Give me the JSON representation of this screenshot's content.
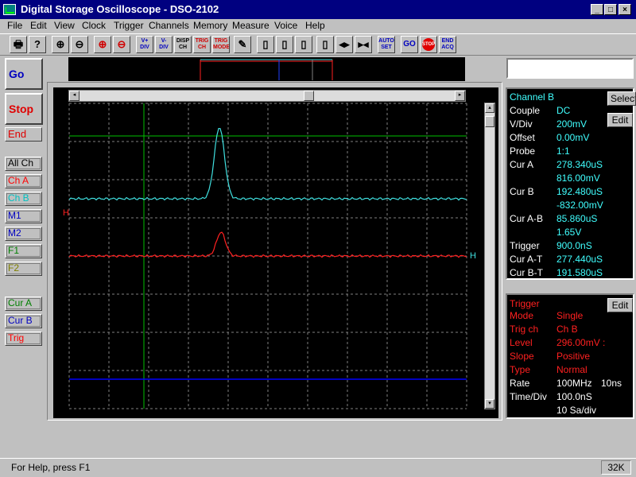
{
  "window": {
    "title": "Digital Storage Oscilloscope - DSO-2102",
    "minimize": "_",
    "maximize": "□",
    "close": "×"
  },
  "menu": [
    "File",
    "Edit",
    "View",
    "Clock",
    "Trigger",
    "Channels",
    "Memory",
    "Measure",
    "Voice",
    "Help"
  ],
  "toolbar": [
    {
      "id": "print",
      "text": "🖶"
    },
    {
      "id": "help",
      "text": "?"
    },
    {
      "id": "zoom-in",
      "text": "⊕"
    },
    {
      "id": "zoom-out",
      "text": "⊖"
    },
    {
      "id": "time-zoom-in",
      "text": "⊕"
    },
    {
      "id": "time-zoom-out",
      "text": "⊖"
    },
    {
      "id": "v-div-up",
      "text": "V+ DIV"
    },
    {
      "id": "v-div-down",
      "text": "V- DIV"
    },
    {
      "id": "disp-ch",
      "text": "DISP CH"
    },
    {
      "id": "trig-ch",
      "text": "TRIG CH"
    },
    {
      "id": "trig-mode",
      "text": "TRIG MODE"
    },
    {
      "id": "pen",
      "text": "✎"
    },
    {
      "id": "layout1",
      "text": "▯"
    },
    {
      "id": "layout2",
      "text": "▯"
    },
    {
      "id": "layout3",
      "text": "▯"
    },
    {
      "id": "layout4",
      "text": "▯"
    },
    {
      "id": "h-expand",
      "text": "◂▸"
    },
    {
      "id": "h-compress",
      "text": "▸◂"
    },
    {
      "id": "h-full",
      "text": "◂▸"
    },
    {
      "id": "auto-set",
      "text": "AUTO SET"
    },
    {
      "id": "go",
      "text": "GO"
    },
    {
      "id": "stop",
      "text": "STOP"
    },
    {
      "id": "end-acq",
      "text": "END ACQ"
    }
  ],
  "side": {
    "go": "Go",
    "stop": "Stop",
    "end": "End",
    "channels": [
      {
        "id": "all",
        "label": "All Ch",
        "color": "#000000"
      },
      {
        "id": "a",
        "label": "Ch A",
        "color": "#ff0000"
      },
      {
        "id": "b",
        "label": "Ch B",
        "color": "#00c0c0"
      },
      {
        "id": "m1",
        "label": "M1",
        "color": "#0000c0"
      },
      {
        "id": "m2",
        "label": "M2",
        "color": "#0000c0"
      },
      {
        "id": "f1",
        "label": "F1",
        "color": "#008000"
      },
      {
        "id": "f2",
        "label": "F2",
        "color": "#808000"
      }
    ],
    "cursors": [
      {
        "id": "cur-a",
        "label": "Cur A",
        "color": "#008000"
      },
      {
        "id": "cur-b",
        "label": "Cur B",
        "color": "#0000c0"
      },
      {
        "id": "trig",
        "label": "Trig",
        "color": "#ff0000"
      }
    ]
  },
  "scope": {
    "grid_color": "#808080",
    "ch_b_color": "#40e0e0",
    "ch_a_color": "#ff2020",
    "cursor_a_color": "#00c000",
    "cursor_b_color": "#0000ff",
    "marker_left": "H",
    "marker_right": "H",
    "scroll_left": "◂",
    "scroll_right": "▸",
    "scroll_up": "▴",
    "scroll_down": "▾"
  },
  "channel_panel": {
    "title": "Channel B",
    "select_label": "Select",
    "edit_label": "Edit",
    "rows": [
      {
        "label": "Couple",
        "value": "DC"
      },
      {
        "label": "V/Div",
        "value": "200mV"
      },
      {
        "label": "Offset",
        "value": "0.00mV"
      },
      {
        "label": "Probe",
        "value": "1:1"
      },
      {
        "label": "Cur A",
        "value": "278.340uS"
      },
      {
        "label": "",
        "value": "816.00mV"
      },
      {
        "label": "Cur B",
        "value": "192.480uS"
      },
      {
        "label": "",
        "value": "-832.00mV"
      },
      {
        "label": "Cur A-B",
        "value": "85.860uS"
      },
      {
        "label": "",
        "value": "1.65V"
      },
      {
        "label": "Trigger",
        "value": "900.0nS"
      },
      {
        "label": "Cur A-T",
        "value": "277.440uS"
      },
      {
        "label": "Cur B-T",
        "value": "191.580uS"
      }
    ]
  },
  "trigger_panel": {
    "title": "Trigger",
    "edit_label": "Edit",
    "rows": [
      {
        "label": "Mode",
        "value": "Single"
      },
      {
        "label": "Trig ch",
        "value": "Ch B"
      },
      {
        "label": "Level",
        "value": "296.00mV :"
      },
      {
        "label": "Slope",
        "value": "Positive"
      },
      {
        "label": "Type",
        "value": "Normal"
      }
    ],
    "rate_label": "Rate",
    "rate_value": "100MHz",
    "rate_period": "10ns",
    "timediv_label": "Time/Div",
    "timediv_value": "100.0nS",
    "samples": "10  Sa/div"
  },
  "status": {
    "help": "For Help, press F1",
    "memory": "32K"
  }
}
